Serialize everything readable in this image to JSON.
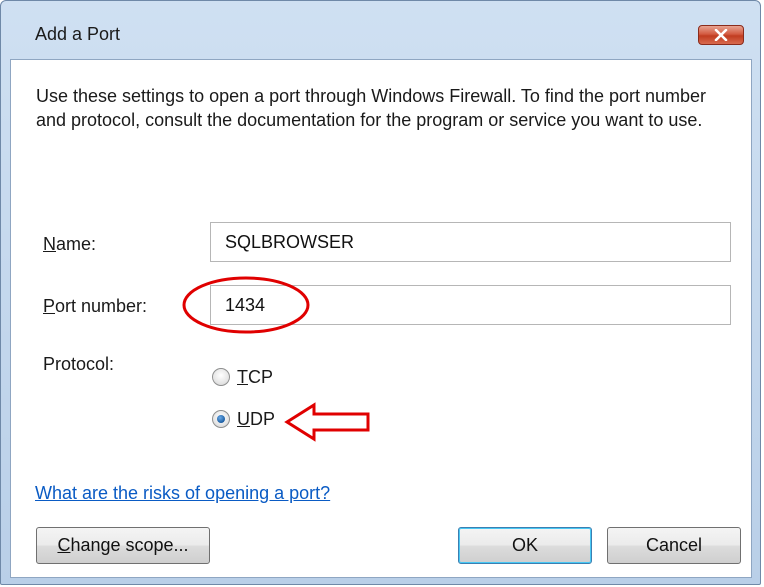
{
  "window": {
    "title": "Add a Port",
    "close_icon": "close-icon"
  },
  "dialog": {
    "description": "Use these settings to open a port through Windows Firewall. To find the port number and protocol, consult the documentation for the program or service you want to use.",
    "name_label": "Name:",
    "name_value": "SQLBROWSER",
    "port_label": "Port number:",
    "port_value": "1434",
    "protocol_label": "Protocol:",
    "protocol_options": [
      {
        "label": "TCP",
        "selected": false
      },
      {
        "label": "UDP",
        "selected": true
      }
    ],
    "risk_link": "What are the risks of opening a port?",
    "change_scope_button": "Change scope...",
    "ok_button": "OK",
    "cancel_button": "Cancel"
  },
  "annotations": {
    "highlight_color": "#e00000",
    "port_circle": "red-ellipse-highlight",
    "udp_arrow": "red-arrow-pointer"
  }
}
